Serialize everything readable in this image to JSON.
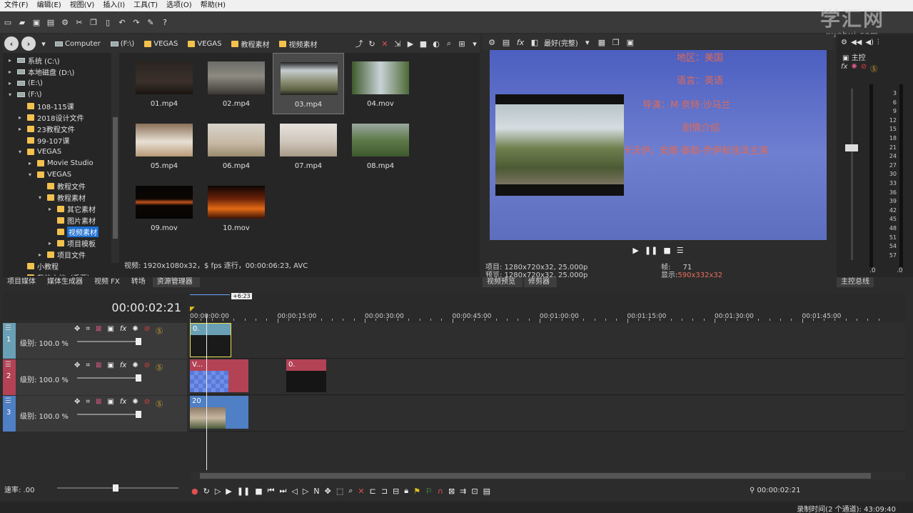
{
  "menu": [
    "文件(F)",
    "编辑(E)",
    "视图(V)",
    "插入(I)",
    "工具(T)",
    "选项(O)",
    "帮助(H)"
  ],
  "watermark": {
    "text": "学汇网",
    "sub": "xuehui.com"
  },
  "explorer": {
    "breadcrumbs": [
      "Computer",
      "(F:\\)",
      "VEGAS",
      "VEGAS",
      "教程素材",
      "视频素材"
    ],
    "tree": [
      {
        "label": "系统 (C:\\)",
        "level": 1,
        "icon": "drive"
      },
      {
        "label": "本地磁盘 (D:\\)",
        "level": 1,
        "icon": "drive"
      },
      {
        "label": "(E:\\)",
        "level": 1,
        "icon": "drive"
      },
      {
        "label": "(F:\\)",
        "level": 1,
        "icon": "drive"
      },
      {
        "label": "108-115课",
        "level": 2,
        "icon": "folder"
      },
      {
        "label": "2018设计文件",
        "level": 2,
        "icon": "folder"
      },
      {
        "label": "23教程文件",
        "level": 2,
        "icon": "folder"
      },
      {
        "label": "99-107课",
        "level": 2,
        "icon": "folder"
      },
      {
        "label": "VEGAS",
        "level": 2,
        "icon": "folder"
      },
      {
        "label": "Movie Studio",
        "level": 3,
        "icon": "folder"
      },
      {
        "label": "VEGAS",
        "level": 3,
        "icon": "folder"
      },
      {
        "label": "教程文件",
        "level": 4,
        "icon": "folder"
      },
      {
        "label": "教程素材",
        "level": 4,
        "icon": "folder"
      },
      {
        "label": "其它素材",
        "level": 5,
        "icon": "folder"
      },
      {
        "label": "图片素材",
        "level": 5,
        "icon": "folder"
      },
      {
        "label": "视频素材",
        "level": 5,
        "icon": "folder",
        "selected": true
      },
      {
        "label": "项目模板",
        "level": 5,
        "icon": "folder"
      },
      {
        "label": "项目文件",
        "level": 4,
        "icon": "folder"
      },
      {
        "label": "小教程",
        "level": 2,
        "icon": "folder"
      },
      {
        "label": "我的文档（重要）",
        "level": 2,
        "icon": "folder"
      }
    ],
    "files": [
      "01.mp4",
      "02.mp4",
      "03.mp4",
      "04.mov",
      "05.mp4",
      "06.mp4",
      "07.mp4",
      "08.mp4",
      "09.mov",
      "10.mov"
    ],
    "selected_file": "03.mp4",
    "status": "视频: 1920x1080x32，$ fps 逐行，00:00:06:23, AVC"
  },
  "left_tabs": [
    "项目媒体",
    "媒体生成器",
    "视频 FX",
    "转场",
    "资源管理器"
  ],
  "preview": {
    "quality": "最好(完整)",
    "overlay_lines": [
      "地区：美国",
      "语言：英语",
      "导演：M·奈特·沙马兰",
      "剧情介绍",
      "卡沃伊，安娜·泰勒-乔伊和佳泽主演"
    ],
    "info_project": "项目: 1280x720x32, 25.000p",
    "info_preview": "预览: 1280x720x32, 25.000p",
    "info_frame_label": "帧:",
    "info_frame": "71",
    "info_display_label": "显示:",
    "info_display": "590x332x32",
    "tabs": [
      "视频预览",
      "修剪器"
    ]
  },
  "master": {
    "label": "主控",
    "scale": [
      "3",
      "6",
      "9",
      "12",
      "15",
      "18",
      "21",
      "24",
      "27",
      "30",
      "33",
      "36",
      "39",
      "42",
      "45",
      "48",
      "51",
      "54",
      "57"
    ],
    "bottom_values": [
      ".0",
      ".0"
    ],
    "tab": "主控总线"
  },
  "timeline": {
    "timecode": "00:00:02:21",
    "region_label": "+6:23",
    "ruler": [
      "00:00:00:00",
      "00:00:15:00",
      "00:00:30:00",
      "00:00:45:00",
      "00:01:00:00",
      "00:01:15:00",
      "00:01:30:00",
      "00:01:45:00"
    ],
    "tracks": [
      {
        "num": "1",
        "level": "级别: 100.0 %",
        "color": "#6aa0b6"
      },
      {
        "num": "2",
        "level": "级别: 100.0 %",
        "color": "#b34255"
      },
      {
        "num": "3",
        "level": "级别: 100.0 %",
        "color": "#4f7fc4"
      }
    ],
    "clips": {
      "t1a": "0.",
      "t2a": "V...",
      "t2b": "0.",
      "t3a": "20"
    },
    "rate": "速率: .00",
    "transport_time": "00:00:02:21"
  },
  "status": "录制时间(2 个通道): 43:09:40",
  "colors": {
    "accent": "#1f6fd1",
    "overlay_text": "#e06a55",
    "track1": "#6aa0b6",
    "track2": "#b34255",
    "track3": "#4f7fc4"
  }
}
